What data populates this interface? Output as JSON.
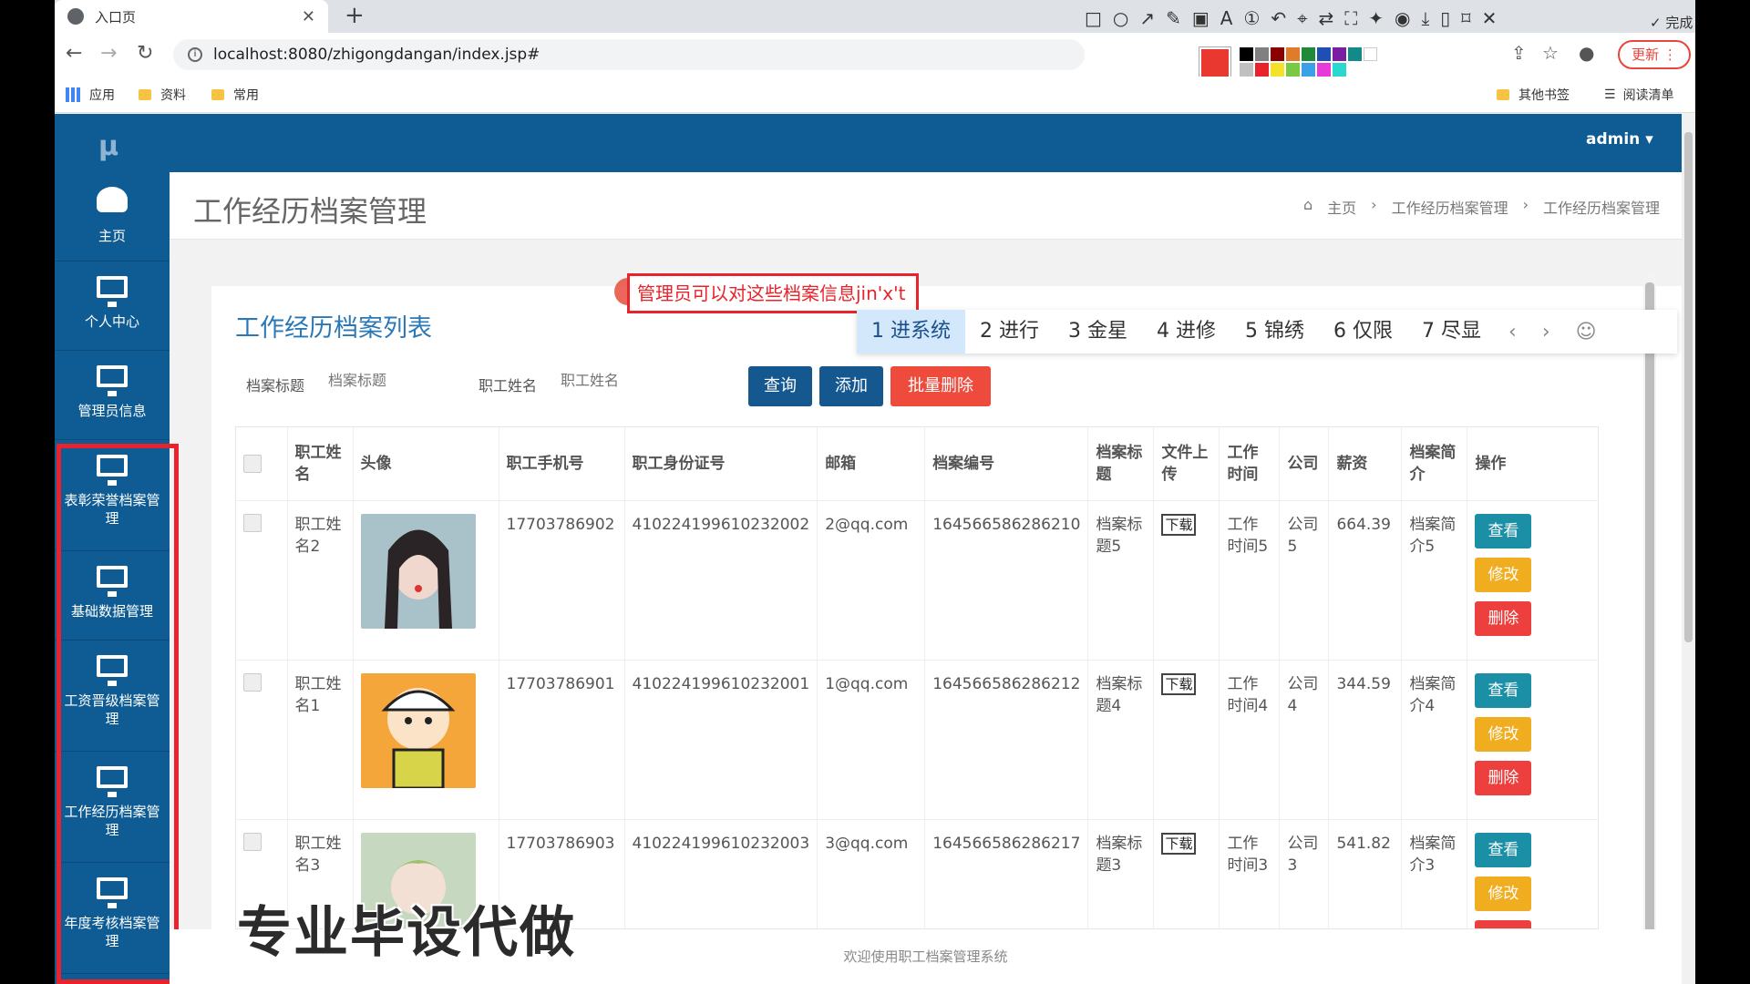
{
  "browser": {
    "tab_title": "入口页",
    "url": "localhost:8080/zhigongdangan/index.jsp#",
    "bookmarks": [
      "应用",
      "资料",
      "常用"
    ],
    "bookmarks_right": [
      "其他书签",
      "阅读清单"
    ],
    "update_label": "更新",
    "done_label": "完成",
    "font_size": "12"
  },
  "app": {
    "logo": "μ",
    "user": "admin ▾",
    "sidebar": [
      {
        "label": "主页",
        "icon": "dashboard-icon"
      },
      {
        "label": "个人中心",
        "icon": "monitor-icon"
      },
      {
        "label": "管理员信息",
        "icon": "monitor-icon"
      },
      {
        "label": "表彰荣誉档案管理",
        "icon": "monitor-icon"
      },
      {
        "label": "基础数据管理",
        "icon": "monitor-icon"
      },
      {
        "label": "工资晋级档案管理",
        "icon": "monitor-icon"
      },
      {
        "label": "工作经历档案管理",
        "icon": "monitor-icon"
      },
      {
        "label": "年度考核档案管理",
        "icon": "monitor-icon"
      }
    ],
    "page_title": "工作经历档案管理",
    "breadcrumb": [
      "主页",
      "工作经历档案管理",
      "工作经历档案管理"
    ],
    "list_title": "工作经历档案列表",
    "search": {
      "label1": "档案标题",
      "placeholder1": "档案标题",
      "label2": "职工姓名",
      "placeholder2": "职工姓名"
    },
    "buttons": {
      "query": "查询",
      "add": "添加",
      "batch_delete": "批量删除"
    },
    "columns": [
      "职工姓名",
      "头像",
      "职工手机号",
      "职工身份证号",
      "邮箱",
      "档案编号",
      "档案标题",
      "文件上传",
      "工作时间",
      "公司",
      "薪资",
      "档案简介",
      "操作"
    ],
    "rows": [
      {
        "name": "职工姓名2",
        "phone": "17703786902",
        "idcard": "410224199610232002",
        "email": "2@qq.com",
        "code": "164566586286210",
        "title": "档案标题5",
        "file": "下载",
        "worktime": "工作时间5",
        "company": "公司5",
        "salary": "664.39",
        "intro": "档案简介5"
      },
      {
        "name": "职工姓名1",
        "phone": "17703786901",
        "idcard": "410224199610232001",
        "email": "1@qq.com",
        "code": "164566586286212",
        "title": "档案标题4",
        "file": "下载",
        "worktime": "工作时间4",
        "company": "公司4",
        "salary": "344.59",
        "intro": "档案简介4"
      },
      {
        "name": "职工姓名3",
        "phone": "17703786903",
        "idcard": "410224199610232003",
        "email": "3@qq.com",
        "code": "164566586286217",
        "title": "档案标题3",
        "file": "下载",
        "worktime": "工作时间3",
        "company": "公司3",
        "salary": "541.82",
        "intro": "档案简介3"
      }
    ],
    "ops": {
      "view": "查看",
      "edit": "修改",
      "delete": "删除"
    },
    "footer": "欢迎使用职工档案管理系统"
  },
  "ime": {
    "input_text": "管理员可以对这些档案信息jin'x't",
    "candidates": [
      "1 进系统",
      "2 进行",
      "3 金星",
      "4 进修",
      "5 锦绣",
      "6 仅限",
      "7 尽显"
    ]
  },
  "watermark": "专业毕设代做",
  "colors": {
    "brand": "#0f5c94",
    "annotation_red": "#e8232b",
    "view": "#1b8fa6",
    "edit": "#f0ad20",
    "delete": "#ee3f3f"
  }
}
